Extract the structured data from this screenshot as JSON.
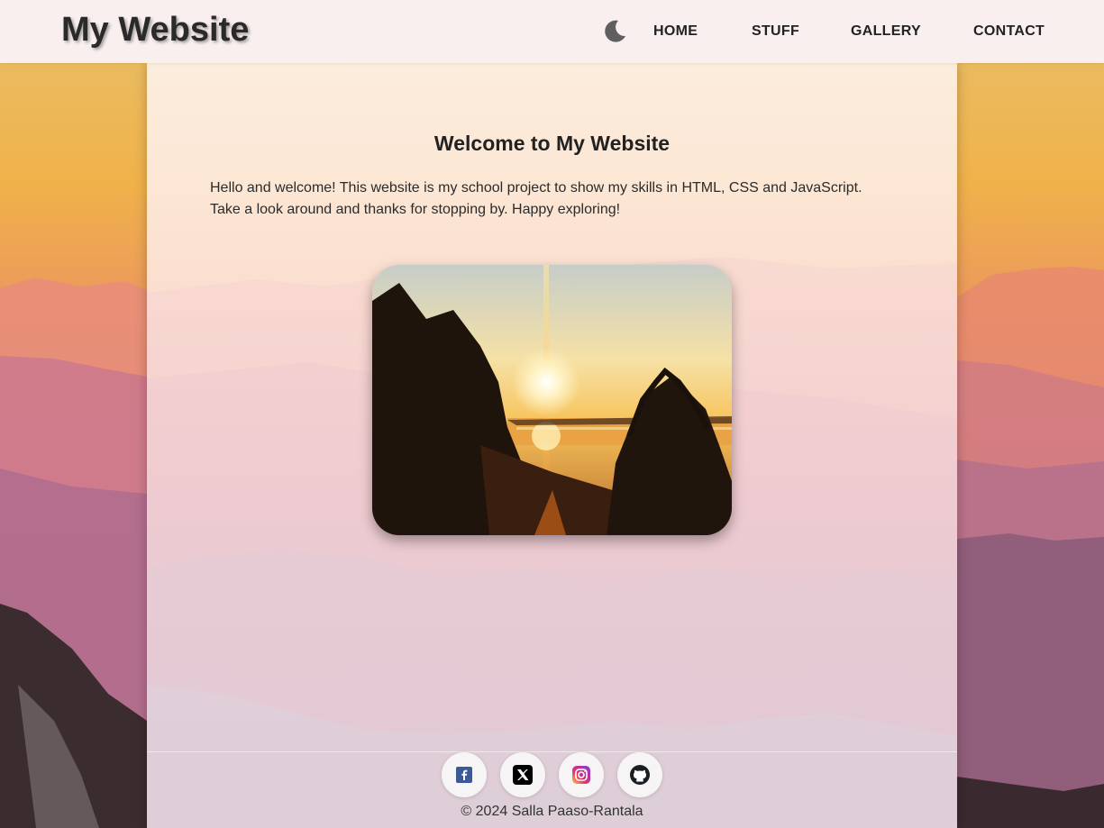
{
  "header": {
    "site_title": "My Website",
    "nav": [
      {
        "label": "HOME"
      },
      {
        "label": "STUFF"
      },
      {
        "label": "GALLERY"
      },
      {
        "label": "CONTACT"
      }
    ],
    "theme_toggle_icon": "moon-icon"
  },
  "main": {
    "heading": "Welcome to My Website",
    "intro": "Hello and welcome! This website is my school project to show my skills in HTML, CSS and JavaScript. Take a look around and thanks for stopping by. Happy exploring!",
    "photo_subject": "sunset over lake path"
  },
  "footer": {
    "social": [
      {
        "icon": "facebook-icon"
      },
      {
        "icon": "x-icon"
      },
      {
        "icon": "instagram-icon"
      },
      {
        "icon": "github-icon"
      }
    ],
    "copyright": "© 2024 Salla Paaso-Rantala"
  },
  "colors": {
    "header_bg": "#f9efef",
    "facebook": "#3b5998",
    "instagram": "#e1306c"
  }
}
